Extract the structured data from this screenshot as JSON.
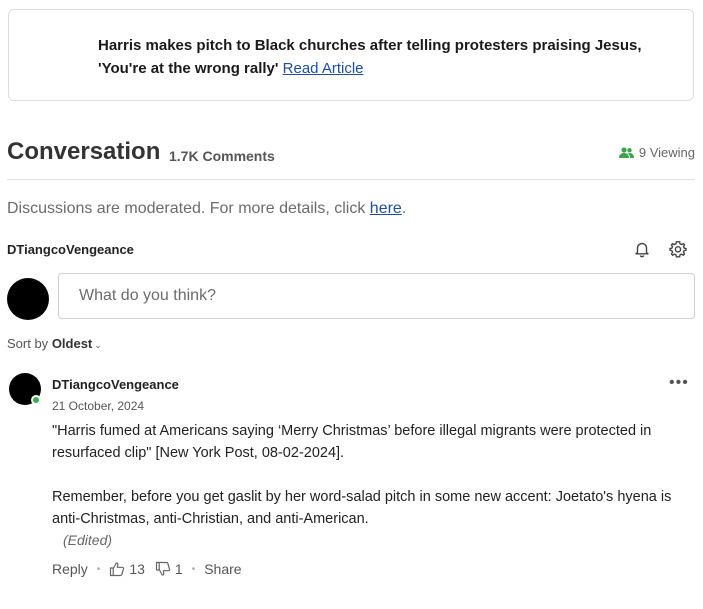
{
  "article": {
    "title": "Harris makes pitch to Black churches after telling protesters praising Jesus, 'You're at the wrong rally'",
    "link_label": "Read Article"
  },
  "conversation": {
    "title": "Conversation",
    "comment_count": "1.7K Comments",
    "viewing": "9 Viewing"
  },
  "moderation": {
    "text": "Discussions are moderated. For more details, click ",
    "link_label": "here",
    "suffix": "."
  },
  "current_user": {
    "name": "DTiangcoVengeance"
  },
  "composer": {
    "placeholder": "What do you think?"
  },
  "sort": {
    "label": "Sort by",
    "value": "Oldest"
  },
  "comment": {
    "author": "DTiangcoVengeance",
    "date": "21 October, 2024",
    "paragraph1": "\"Harris fumed at Americans saying ‘Merry Christmas’ before illegal migrants were protected in resurfaced clip\" [New York Post, 08-02-2024].",
    "paragraph2": "Remember, before you get gaslit by her word-salad pitch in some new accent: Joetato's hyena is anti-Christmas, anti-Christian, and anti-American.",
    "edited": "(Edited)",
    "reply_label": "Reply",
    "likes": "13",
    "dislikes": "1",
    "share_label": "Share"
  },
  "colors": {
    "link": "#1d4ea3",
    "online": "#36b24a",
    "viewing_icon": "#3fa34d"
  }
}
